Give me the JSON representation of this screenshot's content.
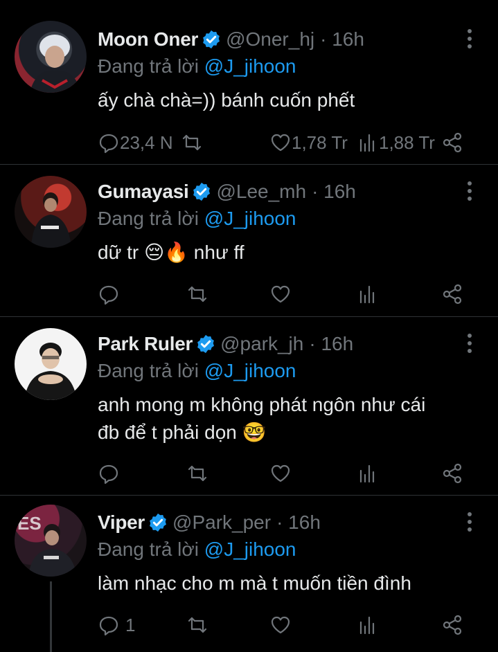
{
  "colors": {
    "background": "#000000",
    "link": "#1d9bf0",
    "muted": "#71767b",
    "text": "#e7e9ea",
    "verified": "#1d9bf0"
  },
  "tweets": [
    {
      "name": "Moon Oner",
      "handle": "@Oner_hj",
      "time": "· 16h",
      "reply_prefix": "Đang trả lời",
      "reply_to": "@J_jihoon",
      "text_lines": [
        "ấy chà chà=)) bánh cuốn phết"
      ],
      "replies": "23,4 N",
      "retweets": "",
      "likes": "1,78 Tr",
      "views": "1,88 Tr"
    },
    {
      "name": "Gumayasi",
      "handle": "@Lee_mh",
      "time": "· 16h",
      "reply_prefix": "Đang trả lời",
      "reply_to": "@J_jihoon",
      "text_lines": [
        "dữ tr 😔🔥 như ff"
      ],
      "replies": "",
      "retweets": "",
      "likes": "",
      "views": ""
    },
    {
      "name": "Park Ruler",
      "handle": "@park_jh",
      "time": "· 16h",
      "reply_prefix": "Đang trả lời",
      "reply_to": "@J_jihoon",
      "text_lines": [
        "anh mong m không phát ngôn như cái",
        "đb để t phải dọn 🤓"
      ],
      "replies": "",
      "retweets": "",
      "likes": "",
      "views": ""
    },
    {
      "name": "Viper",
      "handle": "@Park_per",
      "time": "· 16h",
      "reply_prefix": "Đang trả lời",
      "reply_to": "@J_jihoon",
      "text_lines": [
        "làm nhạc cho m mà t muốn tiền đình"
      ],
      "replies": "1",
      "retweets": "",
      "likes": "",
      "views": ""
    }
  ]
}
